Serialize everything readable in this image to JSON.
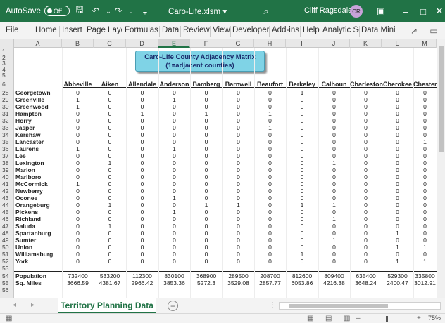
{
  "titlebar": {
    "autosave_label": "AutoSave",
    "autosave_state": "Off",
    "filename": "Caro-Life.xlsm",
    "user_name": "Cliff Ragsdale",
    "user_initials": "CR"
  },
  "ribbon_tabs": [
    "File",
    "Home",
    "Insert",
    "Page Layc",
    "Formulas",
    "Data",
    "Review",
    "View",
    "Developer",
    "Add-ins",
    "Help",
    "Analytic Sc",
    "Data Minii"
  ],
  "columns": [
    "A",
    "B",
    "C",
    "D",
    "E",
    "F",
    "G",
    "H",
    "I",
    "J",
    "K",
    "L",
    "M"
  ],
  "selected_column": "E",
  "title_box": {
    "line1": "Caro-Life County Adjacency Matrix",
    "line2": "(1=adjacent counties)"
  },
  "header_row_label": "6",
  "county_headers": [
    "Abbeville",
    "Aiken",
    "Allendale",
    "Anderson",
    "Bamberg",
    "Barnwell",
    "Beaufort",
    "Berkeley",
    "Calhoun",
    "Charleston",
    "Cherokee",
    "Chester"
  ],
  "top_rows": [
    "1",
    "2",
    "3",
    "4",
    "5"
  ],
  "rows": [
    {
      "num": "28",
      "county": "Georgetown",
      "values": [
        "0",
        "0",
        "0",
        "0",
        "0",
        "0",
        "0",
        "1",
        "0",
        "0",
        "0",
        "0"
      ]
    },
    {
      "num": "29",
      "county": "Greenville",
      "values": [
        "1",
        "0",
        "0",
        "1",
        "0",
        "0",
        "0",
        "0",
        "0",
        "0",
        "0",
        "0"
      ]
    },
    {
      "num": "30",
      "county": "Greenwood",
      "values": [
        "1",
        "0",
        "0",
        "0",
        "0",
        "0",
        "0",
        "0",
        "0",
        "0",
        "0",
        "0"
      ]
    },
    {
      "num": "31",
      "county": "Hampton",
      "values": [
        "0",
        "0",
        "1",
        "0",
        "1",
        "0",
        "1",
        "0",
        "0",
        "0",
        "0",
        "0"
      ]
    },
    {
      "num": "32",
      "county": "Horry",
      "values": [
        "0",
        "0",
        "0",
        "0",
        "0",
        "0",
        "0",
        "0",
        "0",
        "0",
        "0",
        "0"
      ]
    },
    {
      "num": "33",
      "county": "Jasper",
      "values": [
        "0",
        "0",
        "0",
        "0",
        "0",
        "0",
        "1",
        "0",
        "0",
        "0",
        "0",
        "0"
      ]
    },
    {
      "num": "34",
      "county": "Kershaw",
      "values": [
        "0",
        "0",
        "0",
        "0",
        "0",
        "0",
        "0",
        "0",
        "0",
        "0",
        "0",
        "0"
      ]
    },
    {
      "num": "35",
      "county": "Lancaster",
      "values": [
        "0",
        "0",
        "0",
        "0",
        "0",
        "0",
        "0",
        "0",
        "0",
        "0",
        "0",
        "1"
      ]
    },
    {
      "num": "36",
      "county": "Laurens",
      "values": [
        "1",
        "0",
        "0",
        "1",
        "0",
        "0",
        "0",
        "0",
        "0",
        "0",
        "0",
        "0"
      ]
    },
    {
      "num": "37",
      "county": "Lee",
      "values": [
        "0",
        "0",
        "0",
        "0",
        "0",
        "0",
        "0",
        "0",
        "0",
        "0",
        "0",
        "0"
      ]
    },
    {
      "num": "38",
      "county": "Lexington",
      "values": [
        "0",
        "1",
        "0",
        "0",
        "0",
        "0",
        "0",
        "0",
        "1",
        "0",
        "0",
        "0"
      ]
    },
    {
      "num": "39",
      "county": "Marion",
      "values": [
        "0",
        "0",
        "0",
        "0",
        "0",
        "0",
        "0",
        "0",
        "0",
        "0",
        "0",
        "0"
      ]
    },
    {
      "num": "40",
      "county": "Marlboro",
      "values": [
        "0",
        "0",
        "0",
        "0",
        "0",
        "0",
        "0",
        "0",
        "0",
        "0",
        "0",
        "0"
      ]
    },
    {
      "num": "41",
      "county": "McCormick",
      "values": [
        "1",
        "0",
        "0",
        "0",
        "0",
        "0",
        "0",
        "0",
        "0",
        "0",
        "0",
        "0"
      ]
    },
    {
      "num": "42",
      "county": "Newberry",
      "values": [
        "0",
        "0",
        "0",
        "0",
        "0",
        "0",
        "0",
        "0",
        "0",
        "0",
        "0",
        "0"
      ]
    },
    {
      "num": "43",
      "county": "Oconee",
      "values": [
        "0",
        "0",
        "0",
        "1",
        "0",
        "0",
        "0",
        "0",
        "0",
        "0",
        "0",
        "0"
      ]
    },
    {
      "num": "44",
      "county": "Orangeburg",
      "values": [
        "0",
        "1",
        "0",
        "0",
        "1",
        "1",
        "0",
        "1",
        "1",
        "0",
        "0",
        "0"
      ]
    },
    {
      "num": "45",
      "county": "Pickens",
      "values": [
        "0",
        "0",
        "0",
        "1",
        "0",
        "0",
        "0",
        "0",
        "0",
        "0",
        "0",
        "0"
      ]
    },
    {
      "num": "46",
      "county": "Richland",
      "values": [
        "0",
        "0",
        "0",
        "0",
        "0",
        "0",
        "0",
        "0",
        "1",
        "0",
        "0",
        "0"
      ]
    },
    {
      "num": "47",
      "county": "Saluda",
      "values": [
        "0",
        "1",
        "0",
        "0",
        "0",
        "0",
        "0",
        "0",
        "0",
        "0",
        "0",
        "0"
      ]
    },
    {
      "num": "48",
      "county": "Spartanburg",
      "values": [
        "0",
        "0",
        "0",
        "0",
        "0",
        "0",
        "0",
        "0",
        "0",
        "0",
        "1",
        "0"
      ]
    },
    {
      "num": "49",
      "county": "Sumter",
      "values": [
        "0",
        "0",
        "0",
        "0",
        "0",
        "0",
        "0",
        "0",
        "1",
        "0",
        "0",
        "0"
      ]
    },
    {
      "num": "50",
      "county": "Union",
      "values": [
        "0",
        "0",
        "0",
        "0",
        "0",
        "0",
        "0",
        "0",
        "0",
        "0",
        "1",
        "1"
      ]
    },
    {
      "num": "51",
      "county": "Williamsburg",
      "values": [
        "0",
        "0",
        "0",
        "0",
        "0",
        "0",
        "0",
        "1",
        "0",
        "0",
        "0",
        "0"
      ]
    },
    {
      "num": "52",
      "county": "York",
      "values": [
        "0",
        "0",
        "0",
        "0",
        "0",
        "0",
        "0",
        "0",
        "0",
        "0",
        "1",
        "1"
      ]
    }
  ],
  "blank_row": "53",
  "summary": [
    {
      "num": "54",
      "label": "Population",
      "values": [
        "732400",
        "533200",
        "112300",
        "830100",
        "368900",
        "289500",
        "208700",
        "812600",
        "809400",
        "635400",
        "529300",
        "335800"
      ]
    },
    {
      "num": "55",
      "label": "Sq. Miles",
      "values": [
        "3666.59",
        "4381.67",
        "2966.42",
        "3853.36",
        "5272.3",
        "3529.08",
        "2857.77",
        "6053.86",
        "4216.38",
        "3648.24",
        "2400.47",
        "3012.91"
      ]
    }
  ],
  "last_row": "56",
  "sheet_tab": "Territory Planning Data",
  "zoom": "75%"
}
